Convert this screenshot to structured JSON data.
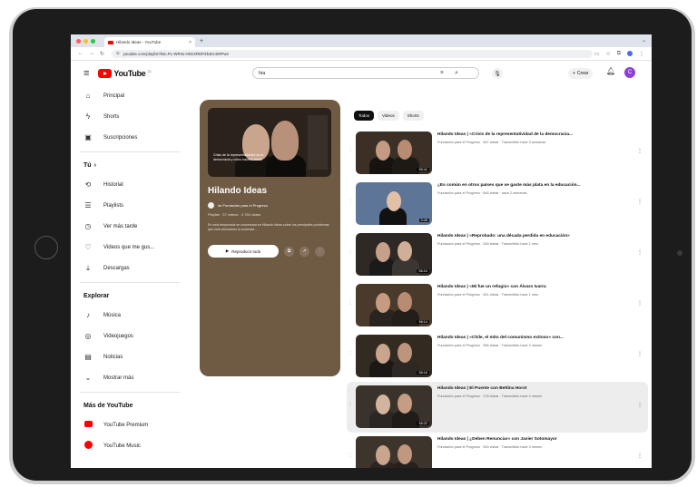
{
  "browser": {
    "tab_title": "Hilando Ideas - YouTube",
    "tab_close": "×",
    "new_tab": "+",
    "url": "youtube.com/playlist?list=PL-WRrw-HkGXRDPZk4KnSRPw4",
    "nav_back": "←",
    "nav_forward": "→",
    "nav_reload": "↻"
  },
  "youtube": {
    "logo_text": "YouTube",
    "logo_country": "CL",
    "search_value": "hia",
    "search_clear": "×",
    "create_label": "Crear",
    "avatar_letter": "C"
  },
  "sidebar": {
    "main": [
      {
        "icon": "home-icon",
        "glyph": "⌂",
        "label": "Principal"
      },
      {
        "icon": "shorts-icon",
        "glyph": "ϟ",
        "label": "Shorts"
      },
      {
        "icon": "subscriptions-icon",
        "glyph": "▣",
        "label": "Suscripciones"
      }
    ],
    "you_header": "Tú",
    "you": [
      {
        "icon": "history-icon",
        "glyph": "⟲",
        "label": "Historial"
      },
      {
        "icon": "playlists-icon",
        "glyph": "☰",
        "label": "Playlists"
      },
      {
        "icon": "watch-later-icon",
        "glyph": "◷",
        "label": "Ver más tarde"
      },
      {
        "icon": "liked-icon",
        "glyph": "♡",
        "label": "Videos que me gus..."
      },
      {
        "icon": "downloads-icon",
        "glyph": "⤓",
        "label": "Descargas"
      }
    ],
    "explore_header": "Explorar",
    "explore": [
      {
        "icon": "music-icon",
        "glyph": "♪",
        "label": "Música"
      },
      {
        "icon": "gaming-icon",
        "glyph": "◎",
        "label": "Videojuegos"
      },
      {
        "icon": "news-icon",
        "glyph": "▤",
        "label": "Noticias"
      },
      {
        "icon": "chevron-down-icon",
        "glyph": "⌄",
        "label": "Mostrar más"
      }
    ],
    "more_header": "Más de YouTube",
    "more": [
      {
        "icon": "youtube-premium-icon",
        "label": "YouTube Premium"
      },
      {
        "icon": "youtube-music-icon",
        "label": "YouTube Music"
      }
    ]
  },
  "playlist": {
    "title": "Hilando Ideas",
    "channel": "de Fundación para el Progreso",
    "meta": "Playlist · 37 videos · 2.784 vistas",
    "description": "En esta temporada se conversará en Hilando Ideas sobre los principales problemas que está afrontando la sociedad...",
    "thumb_caption": "Crisis de la representatividad de la democracia y cómo hacerle frente",
    "play_all": "Reproducir todo"
  },
  "chips": [
    "Todos",
    "Videos",
    "Shorts"
  ],
  "videos": [
    {
      "title": "Hilando Ideas | «Crisis de la representatividad de la democracia...",
      "meta": "Fundación para el Progreso · 467 vistas · Transmitido hace 3 semanas",
      "duration": "58:41",
      "bg": "#3b2f26",
      "skin1": "#c49b82",
      "skin2": "#b88c73",
      "cloth1": "#171310",
      "cloth2": "#1d1915"
    },
    {
      "title": "¿Es común en otros países que se gaste más plata en la educación...",
      "meta": "Fundación para el Progreso · 646 vistas · hace 2 semanas",
      "duration": "0:45",
      "bg": "#5d7596",
      "skin1": "#e2c0a8",
      "skin2": "#5d7596",
      "cloth1": "#111111",
      "cloth2": "#5d7596"
    },
    {
      "title": "Hilando Ideas | «Reprobado: una década perdida en educación»",
      "meta": "Fundación para el Progreso · 345 vistas · Transmitido hace 1 mes",
      "duration": "56:24",
      "bg": "#2f2925",
      "skin1": "#c6a08a",
      "skin2": "#d1ae97",
      "cloth1": "#1b1a1a",
      "cloth2": "#3c3633"
    },
    {
      "title": "Hilando Ideas | «Mi fue un refugio» con Álvaro Ivarra",
      "meta": "Fundación para el Progreso · 451 vistas · Transmitido hace 1 mes",
      "duration": "58:14",
      "bg": "#4a3a2c",
      "skin1": "#c79b80",
      "skin2": "#b88c73",
      "cloth1": "#2a2420",
      "cloth2": "#241e1a"
    },
    {
      "title": "Hilando Ideas | «Chile, el mito del comunismo exitoso» con...",
      "meta": "Fundación para el Progreso · 356 vistas · Transmitido hace 2 meses",
      "duration": "58:16",
      "bg": "#332a22",
      "skin1": "#c9a58d",
      "skin2": "#bd957d",
      "cloth1": "#1c1815",
      "cloth2": "#2e2824"
    },
    {
      "title": "Hilando Ideas | El Puente con Bettina Horst",
      "meta": "Fundación para el Progreso · 178 vistas · Transmitido hace 2 meses",
      "duration": "58:22",
      "bg": "#3a332c",
      "skin1": "#d3b49e",
      "skin2": "#c59c84",
      "cloth1": "#2b2724",
      "cloth2": "#1f1c1a"
    },
    {
      "title": "Hilando Ideas | ¿Deben Renunciar» con Javier Sotomayor",
      "meta": "Fundación para el Progreso · 263 vistas · Transmitido hace 3 meses",
      "duration": "58:08",
      "bg": "#3d342c",
      "skin1": "#c9a58d",
      "skin2": "#bf987f",
      "cloth1": "#2a2521",
      "cloth2": "#26211d"
    }
  ],
  "colors": {
    "accent": "#ff0000",
    "panel": "#6f5a44",
    "avatar": "#8e3fd6"
  }
}
